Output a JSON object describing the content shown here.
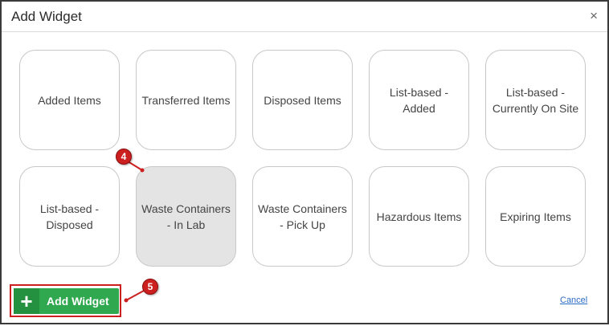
{
  "dialog": {
    "title": "Add Widget",
    "close_icon": "close-icon",
    "close_glyph": "×"
  },
  "widgets": [
    {
      "label": "Added Items",
      "selected": false
    },
    {
      "label": "Transferred Items",
      "selected": false
    },
    {
      "label": "Disposed Items",
      "selected": false
    },
    {
      "label": "List-based - Added",
      "selected": false
    },
    {
      "label": "List-based - Currently On Site",
      "selected": false
    },
    {
      "label": "List-based - Disposed",
      "selected": false
    },
    {
      "label": "Waste Containers - In Lab",
      "selected": true
    },
    {
      "label": "Waste Containers - Pick Up",
      "selected": false
    },
    {
      "label": "Hazardous Items",
      "selected": false
    },
    {
      "label": "Expiring Items",
      "selected": false
    }
  ],
  "callouts": [
    {
      "number": "4"
    },
    {
      "number": "5"
    }
  ],
  "footer": {
    "add_button_label": "Add Widget",
    "add_icon": "plus-icon",
    "add_glyph": "+",
    "cancel_label": "Cancel"
  },
  "colors": {
    "primary_button": "#2fa84f",
    "callout": "#cc1f1f",
    "selected_tile": "#e4e4e4",
    "link": "#2b6cc4"
  }
}
